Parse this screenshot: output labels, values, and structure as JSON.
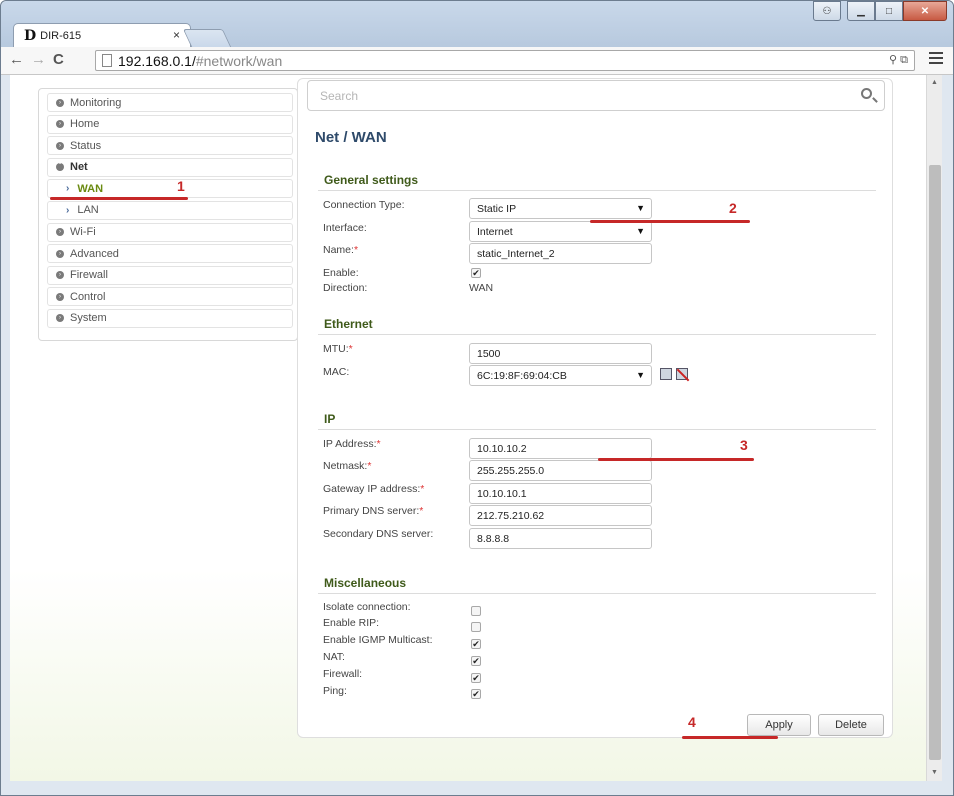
{
  "browser": {
    "tab_logo": "D",
    "tab_title": "DIR-615",
    "tab_close": "×",
    "url_host": "192.168.0.1/",
    "url_path": "#network/wan",
    "window_controls": {
      "user": "⚇",
      "min": "▁",
      "max": "□",
      "close": "✕"
    }
  },
  "sidebar": {
    "items": [
      {
        "label": "Monitoring"
      },
      {
        "label": "Home"
      },
      {
        "label": "Status"
      },
      {
        "label": "Net"
      },
      {
        "label": "WAN"
      },
      {
        "label": "LAN"
      },
      {
        "label": "Wi-Fi"
      },
      {
        "label": "Advanced"
      },
      {
        "label": "Firewall"
      },
      {
        "label": "Control"
      },
      {
        "label": "System"
      }
    ]
  },
  "search": {
    "placeholder": "Search"
  },
  "page": {
    "title": "Net /  WAN"
  },
  "general": {
    "title": "General settings",
    "connection_type_label": "Connection Type:",
    "connection_type_value": "Static IP",
    "interface_label": "Interface:",
    "interface_value": "Internet",
    "name_label": "Name:",
    "name_value": "static_Internet_2",
    "enable_label": "Enable:",
    "enable_checked": true,
    "direction_label": "Direction:",
    "direction_value": "WAN"
  },
  "ethernet": {
    "title": "Ethernet",
    "mtu_label": "MTU:",
    "mtu_value": "1500",
    "mac_label": "MAC:",
    "mac_value": "6C:19:8F:69:04:CB"
  },
  "ip": {
    "title": "IP",
    "ip_label": "IP Address:",
    "ip_value": "10.10.10.2",
    "netmask_label": "Netmask:",
    "netmask_value": "255.255.255.0",
    "gateway_label": "Gateway IP address:",
    "gateway_value": "10.10.10.1",
    "dns1_label": "Primary DNS server:",
    "dns1_value": "212.75.210.62",
    "dns2_label": "Secondary DNS server:",
    "dns2_value": "8.8.8.8"
  },
  "misc": {
    "title": "Miscellaneous",
    "isolate_label": "Isolate connection:",
    "isolate_checked": false,
    "rip_label": "Enable RIP:",
    "rip_checked": false,
    "igmp_label": "Enable IGMP Multicast:",
    "igmp_checked": true,
    "nat_label": "NAT:",
    "nat_checked": true,
    "firewall_label": "Firewall:",
    "firewall_checked": true,
    "ping_label": "Ping:",
    "ping_checked": true
  },
  "buttons": {
    "apply": "Apply",
    "delete": "Delete"
  },
  "annotations": [
    "1",
    "2",
    "3",
    "4"
  ],
  "symbols": {
    "required": "*",
    "checkmark": "✔",
    "caret": "▼"
  },
  "colors": {
    "accent_green": "#6a8a10",
    "annotation_red": "#c62828",
    "title_blue": "#2e4a6a"
  }
}
